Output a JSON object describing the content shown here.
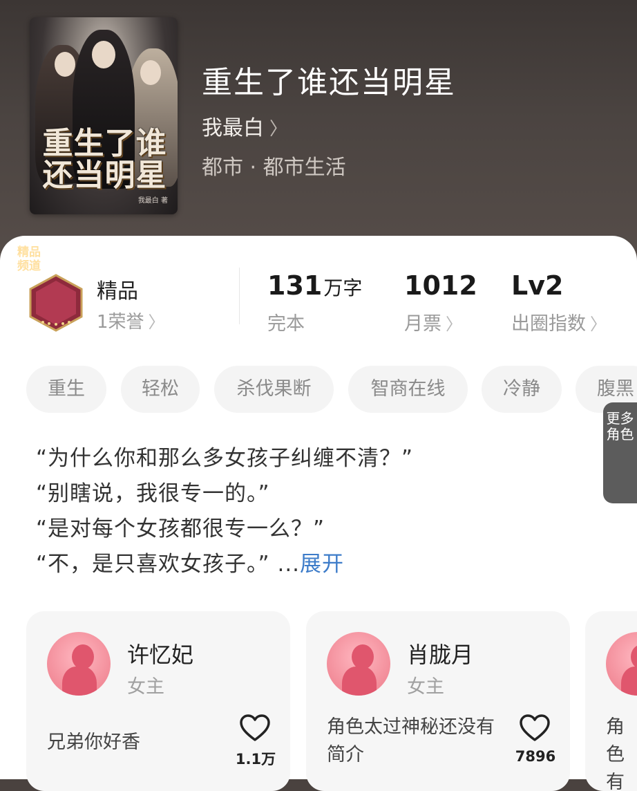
{
  "book": {
    "title": "重生了谁还当明星",
    "author": "我最白",
    "genre": "都市 · 都市生活",
    "cover": {
      "title_art": "重生了谁还当明星",
      "author_mark": "我最白 著"
    }
  },
  "stats": {
    "honor": {
      "label": "精品",
      "sub": "1荣誉",
      "badge_text": "精品频道"
    },
    "words": {
      "value": "131",
      "unit": "万字",
      "label": "完本"
    },
    "tickets": {
      "value": "1012",
      "label": "月票"
    },
    "circle": {
      "value": "Lv2",
      "label": "出圈指数"
    }
  },
  "tags": [
    "重生",
    "轻松",
    "杀伐果断",
    "智商在线",
    "冷静",
    "腹黑"
  ],
  "intro": {
    "lines": [
      "“为什么你和那么多女孩子纠缠不清？”",
      "“别瞎说，我很专一的。”",
      "“是对每个女孩都很专一么？”",
      "“不，是只喜欢女孩子。”"
    ],
    "ellipsis": " ...",
    "expand_label": "展开"
  },
  "characters": [
    {
      "name": "许忆妃",
      "role": "女主",
      "desc": "兄弟你好香",
      "likes": "1.1万"
    },
    {
      "name": "肖胧月",
      "role": "女主",
      "desc": "角色太过神秘还没有简介",
      "likes": "7896"
    }
  ],
  "more_characters_label": "更多角色",
  "partial_card_text": "角色 有简",
  "colors": {
    "link": "#3d7cc9",
    "heart": "#222222"
  }
}
